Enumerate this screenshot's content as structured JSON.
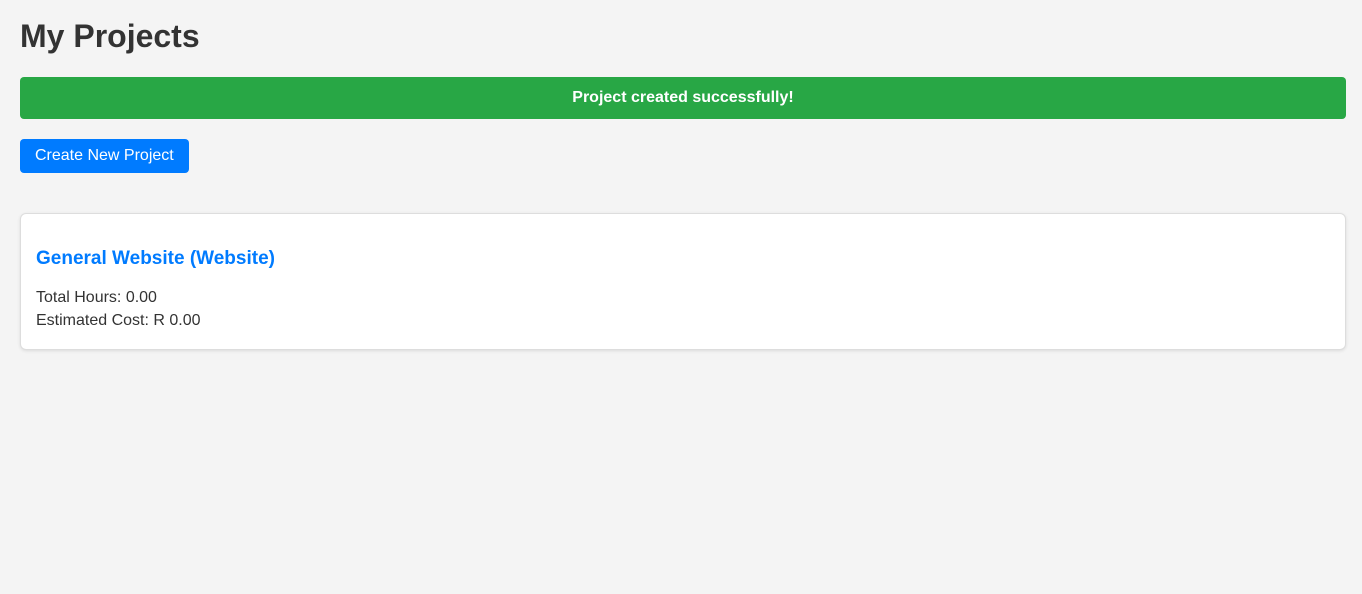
{
  "page": {
    "title": "My Projects"
  },
  "alert": {
    "message": "Project created successfully!",
    "color": "#28a745"
  },
  "actions": {
    "create_label": "Create New Project",
    "accent_color": "#007bff"
  },
  "projects": [
    {
      "name": "General Website (Website)",
      "total_hours": "Total Hours: 0.00",
      "estimated_cost": "Estimated Cost: R 0.00"
    }
  ]
}
